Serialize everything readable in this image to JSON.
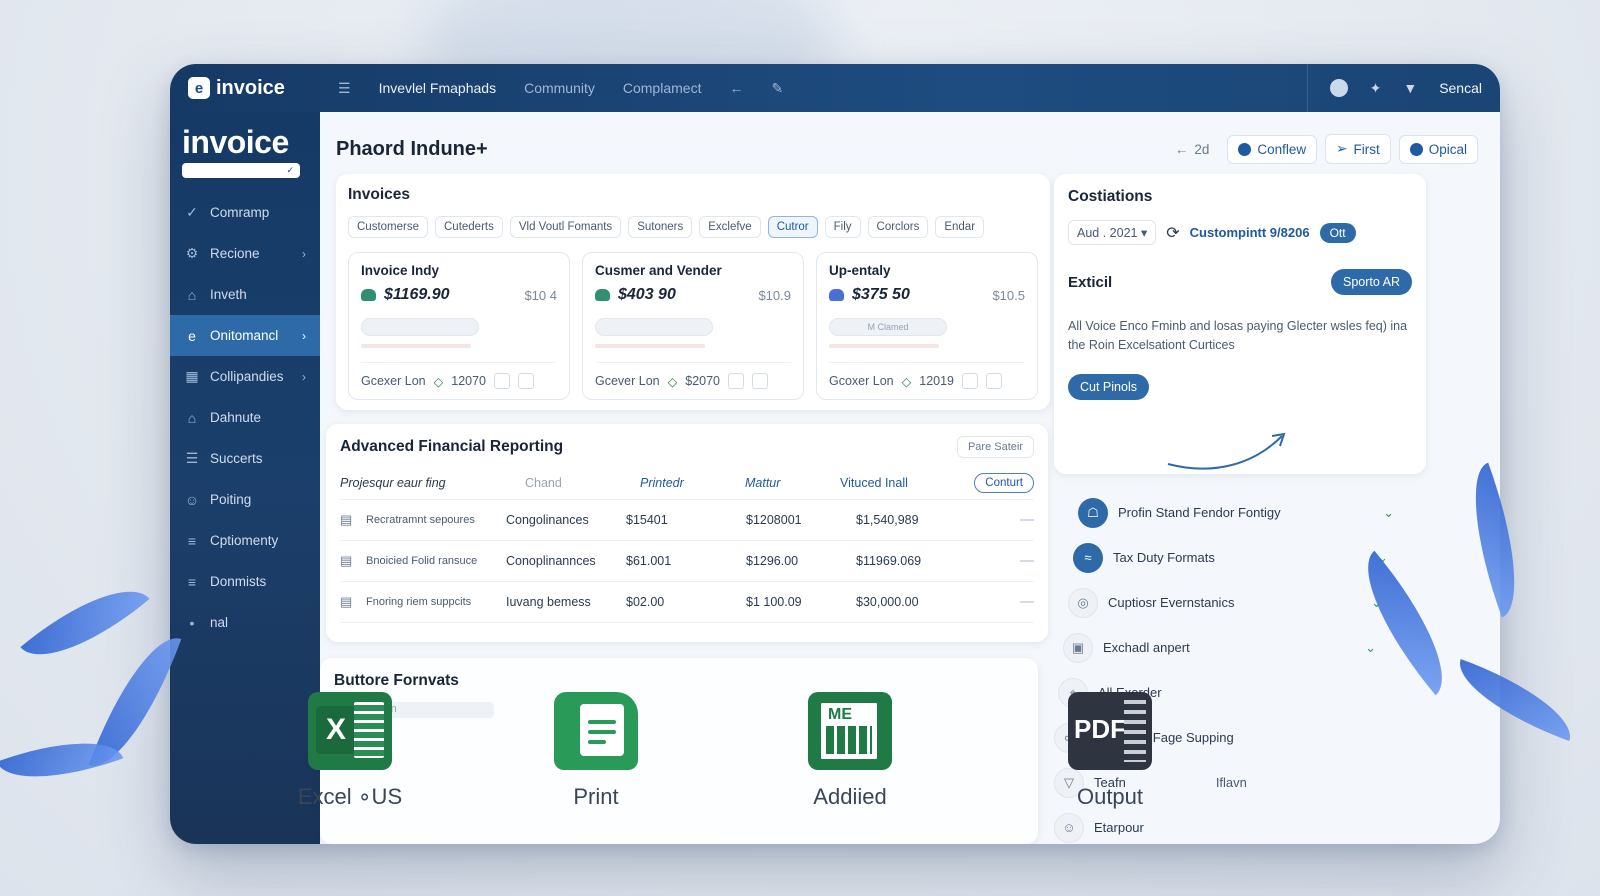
{
  "topbar": {
    "brand": "invoice",
    "nav": [
      {
        "label": "Invevlel Fmaphads",
        "dim": false
      },
      {
        "label": "Community",
        "dim": true
      },
      {
        "label": "Complamect",
        "dim": true
      }
    ],
    "right_label": "Sencal"
  },
  "sidebar": {
    "logo_word": "invoice",
    "items": [
      {
        "label": "Comramp",
        "icon": "check-icon",
        "chevron": false,
        "active": false
      },
      {
        "label": "Recione",
        "icon": "gear-icon",
        "chevron": true,
        "active": false
      },
      {
        "label": "Inveth",
        "icon": "building-icon",
        "chevron": false,
        "active": false
      },
      {
        "label": "Onitomancl",
        "icon": "e-icon",
        "chevron": true,
        "active": true
      },
      {
        "label": "Collipandies",
        "icon": "grid-icon",
        "chevron": true,
        "active": false
      },
      {
        "label": "Dahnute",
        "icon": "tag-icon",
        "chevron": false,
        "active": false
      },
      {
        "label": "Succerts",
        "icon": "doc-icon",
        "chevron": false,
        "active": false
      },
      {
        "label": "Poiting",
        "icon": "person-icon",
        "chevron": false,
        "active": false
      },
      {
        "label": "Cptiomenty",
        "icon": "list-icon",
        "chevron": false,
        "active": false
      },
      {
        "label": "Donmists",
        "icon": "chart-icon",
        "chevron": false,
        "active": false
      },
      {
        "label": "nal",
        "icon": "dot-icon",
        "chevron": false,
        "active": false
      }
    ]
  },
  "header": {
    "title": "Phaord Indune+",
    "back_label": "2d",
    "actions": [
      {
        "label": "Conflew",
        "icon": "person-icon"
      },
      {
        "label": "First",
        "icon": "pin-icon"
      },
      {
        "label": "Opical",
        "icon": "circle-icon"
      }
    ]
  },
  "invoices": {
    "title": "Invoices",
    "filters": [
      {
        "label": "Customerse",
        "selected": false
      },
      {
        "label": "Cutederts",
        "selected": false
      },
      {
        "label": "Vld Voutl Fomants",
        "selected": false
      },
      {
        "label": "Sutoners",
        "selected": false
      },
      {
        "label": "Exclefve",
        "selected": false
      },
      {
        "label": "Cutror",
        "selected": true
      },
      {
        "label": "Fily",
        "selected": false
      },
      {
        "label": "Corclors",
        "selected": false
      },
      {
        "label": "Endar",
        "selected": false
      }
    ],
    "cards": [
      {
        "title": "Invoice Indy",
        "amount": "$1169.90",
        "side": "$10 4",
        "footer_label": "Gcexer Lon",
        "footer_num": "12070"
      },
      {
        "title": "Cusmer and Vender",
        "amount": "$403 90",
        "side": "$10.9",
        "footer_label": "Gcever Lon",
        "footer_num": "$2070"
      },
      {
        "title": "Up-entaly",
        "amount": "$375 50",
        "side": "$10.5",
        "footer_label": "Gcoxer Lon",
        "footer_num": "12019"
      }
    ],
    "card3_pill": "M Clamed"
  },
  "reporting": {
    "title": "Advanced Financial Reporting",
    "toggle_label": "Pare Sateir",
    "columns": {
      "c0": "Projesqur eaur fing",
      "c1": "Chand",
      "c2": "Printedr",
      "c3": "Mattur",
      "c4": "Vituced Inall",
      "button": "Conturt"
    },
    "rows": [
      {
        "name": "Recratramnt sepoures",
        "cat": "Congolinances",
        "v1": "$15401",
        "v2": "$1208001",
        "v3": "$1,540,989"
      },
      {
        "name": "Bnoicied Folid ransuce",
        "cat": "Conoplinannces",
        "v1": "$61.001",
        "v2": "$1296.00",
        "v3": "$11969.069"
      },
      {
        "name": "Fnoring riem suppcits",
        "cat": "Iuvang bemess",
        "v1": "$02.00",
        "v2": "$1 100.09",
        "v3": "$30,000.00"
      }
    ]
  },
  "formats": {
    "title": "Buttore Fornvats",
    "placeholder": "Custmeadin",
    "items": [
      {
        "label": "Excel ∘US"
      },
      {
        "label": "Print"
      },
      {
        "label": "Addiied"
      },
      {
        "label": "Output"
      }
    ]
  },
  "right_panel": {
    "title": "Costiations",
    "select_value": "Aud . 2021",
    "link_label": "Custompintt 9/8206",
    "toggle_label": "Ott",
    "excel_title": "Exticil",
    "excel_button": "Sporto AR",
    "description": "All Voice Enco Fminb and losas paying Glecter wsles feq) ina the Roin Excelsationt Curtices",
    "cut_button": "Cut Pinols",
    "features": [
      {
        "label": "Profin Stand Fendor Fontigy",
        "icon": "lock-icon",
        "style": "blue",
        "check": true
      },
      {
        "label": "Tax Duty Formats",
        "icon": "waveform-icon",
        "style": "blue",
        "check": true
      },
      {
        "label": "Cuptiosr Evernstanics",
        "icon": "globe-icon",
        "style": "light",
        "check": true
      },
      {
        "label": "Exchadl anpert",
        "icon": "bag-icon",
        "style": "light",
        "check": true
      },
      {
        "label": "All Exorder",
        "icon": "pin-icon",
        "style": "light",
        "check": false
      },
      {
        "label": "ToealTive Fage Supping",
        "icon": "share-icon",
        "style": "light",
        "check": false
      },
      {
        "label": "Teafn",
        "icon": "shield-icon",
        "style": "light",
        "check": false
      },
      {
        "label": "Etarpour",
        "icon": "person-icon",
        "style": "light",
        "check": false
      }
    ],
    "iflavn_label": "Iflavn"
  },
  "colors": {
    "primary": "#2f6aa8",
    "nav_dark": "#163a66",
    "excel_green": "#1f7a46"
  }
}
